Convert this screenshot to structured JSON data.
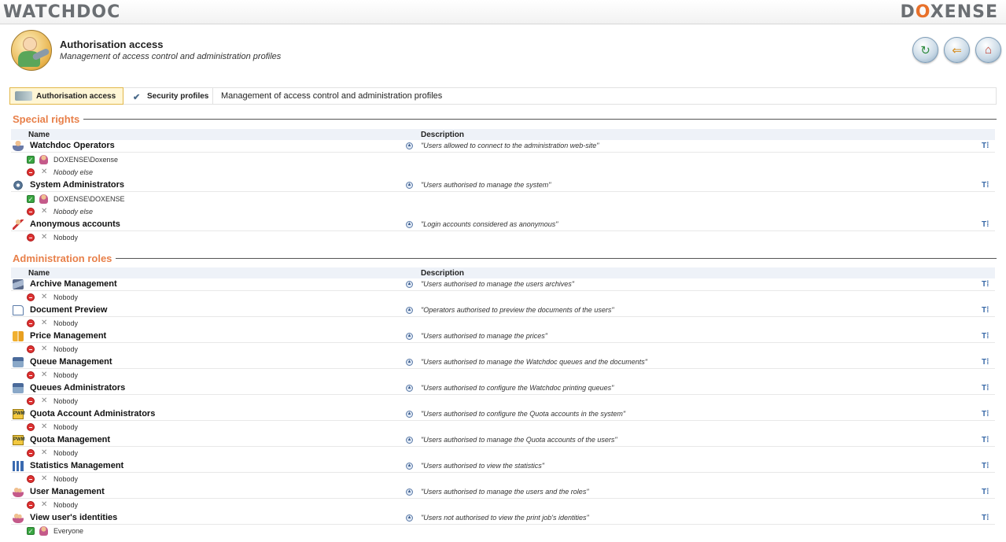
{
  "brand": {
    "left_logo": "WATCHDOC",
    "right_logo_pre": "D",
    "right_logo_o": "O",
    "right_logo_post": "XENSE"
  },
  "header": {
    "title": "Authorisation access",
    "subtitle": "Management of access control and administration profiles"
  },
  "nav_buttons": {
    "refresh": "↻",
    "back": "⇐",
    "home": "⌂"
  },
  "tabs": {
    "authorisation": "Authorisation access",
    "security": "Security profiles",
    "description": "Management of access control and administration profiles"
  },
  "special_rights": {
    "title": "Special rights",
    "col_name": "Name",
    "col_desc": "Description",
    "rows": [
      {
        "name": "Watchdoc Operators",
        "desc": "\"Users allowed to connect to the administration web-site\"",
        "allow": "DOXENSE\\Doxense",
        "deny": "Nobody else"
      },
      {
        "name": "System Administrators",
        "desc": "\"Users authorised to manage the system\"",
        "allow": "DOXENSE\\DOXENSE",
        "deny": "Nobody else"
      },
      {
        "name": "Anonymous accounts",
        "desc": "\"Login accounts considered as anonymous\"",
        "deny": "Nobody"
      }
    ]
  },
  "admin_roles": {
    "title": "Administration roles",
    "col_name": "Name",
    "col_desc": "Description",
    "rows": [
      {
        "name": "Archive Management",
        "desc": "\"Users authorised to manage the users archives\"",
        "deny": "Nobody"
      },
      {
        "name": "Document Preview",
        "desc": "\"Operators authorised to preview the documents of the users\"",
        "deny": "Nobody"
      },
      {
        "name": "Price Management",
        "desc": "\"Users authorised to manage the prices\"",
        "deny": "Nobody"
      },
      {
        "name": "Queue Management",
        "desc": "\"Users authorised to manage the Watchdoc queues and the documents\"",
        "deny": "Nobody"
      },
      {
        "name": "Queues Administrators",
        "desc": "\"Users authorised to configure the Watchdoc printing queues\"",
        "deny": "Nobody"
      },
      {
        "name": "Quota Account Administrators",
        "desc": "\"Users authorised to configure the Quota accounts in the system\"",
        "deny": "Nobody"
      },
      {
        "name": "Quota Management",
        "desc": "\"Users authorised to manage the Quota accounts of the users\"",
        "deny": "Nobody"
      },
      {
        "name": "Statistics Management",
        "desc": "\"Users authorised to view the statistics\"",
        "deny": "Nobody"
      },
      {
        "name": "User Management",
        "desc": "\"Users authorised to manage the users and the roles\"",
        "deny": "Nobody"
      },
      {
        "name": "View user's identities",
        "desc": "\"Users not authorised to view the print job's identities\"",
        "allow": "Everyone"
      }
    ]
  },
  "icon_text": {
    "pwm": "PWM",
    "arrow": "▲",
    "tool": "T⁞",
    "check": "✓",
    "cross": "✕",
    "pen": "✔"
  }
}
